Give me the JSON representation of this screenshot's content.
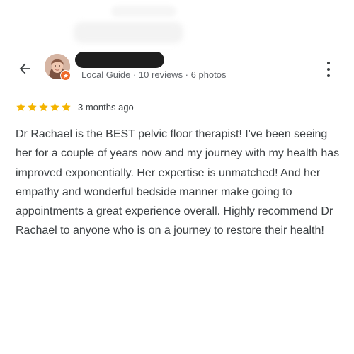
{
  "reviewer": {
    "meta": "Local Guide · 10 reviews · 6 photos",
    "rating": 5,
    "rating_max": 5
  },
  "review": {
    "time_ago": "3 months ago",
    "text": "Dr Rachael is the BEST pelvic floor therapist! I've been seeing her for a couple of years now and my journey with my health has improved exponentially. Her expertise is unmatched! And her empathy and wonderful bedside manner make going to appointments a great experience overall. Highly recommend Dr Rachael to anyone who is on a journey to restore their health!"
  },
  "icons": {
    "back": "arrow-back-icon",
    "more": "more-vert-icon",
    "star": "star-icon",
    "badge": "local-guide-badge-icon"
  },
  "colors": {
    "star": "#f4b400",
    "badge": "#ee6a2b",
    "text": "#3c4043",
    "meta": "#5f6368",
    "redaction": "#1f1f1f"
  }
}
